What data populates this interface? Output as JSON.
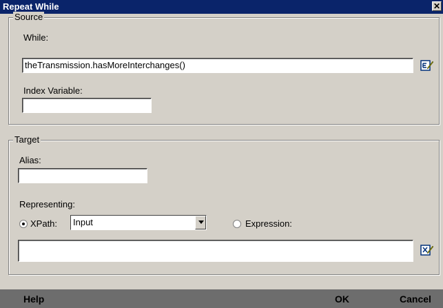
{
  "window": {
    "title": "Repeat While",
    "close_label": "✕"
  },
  "source": {
    "legend": "Source",
    "while_label": "While:",
    "while_value": "theTransmission.hasMoreInterchanges()",
    "index_label": "Index Variable:",
    "index_value": ""
  },
  "target": {
    "legend": "Target",
    "alias_label": "Alias:",
    "alias_value": "",
    "representing_label": "Representing:",
    "xpath_label": "XPath:",
    "xpath_selected": "Input",
    "expression_label": "Expression:",
    "expression_value": ""
  },
  "buttons": {
    "help": "Help",
    "ok": "OK",
    "cancel": "Cancel"
  }
}
